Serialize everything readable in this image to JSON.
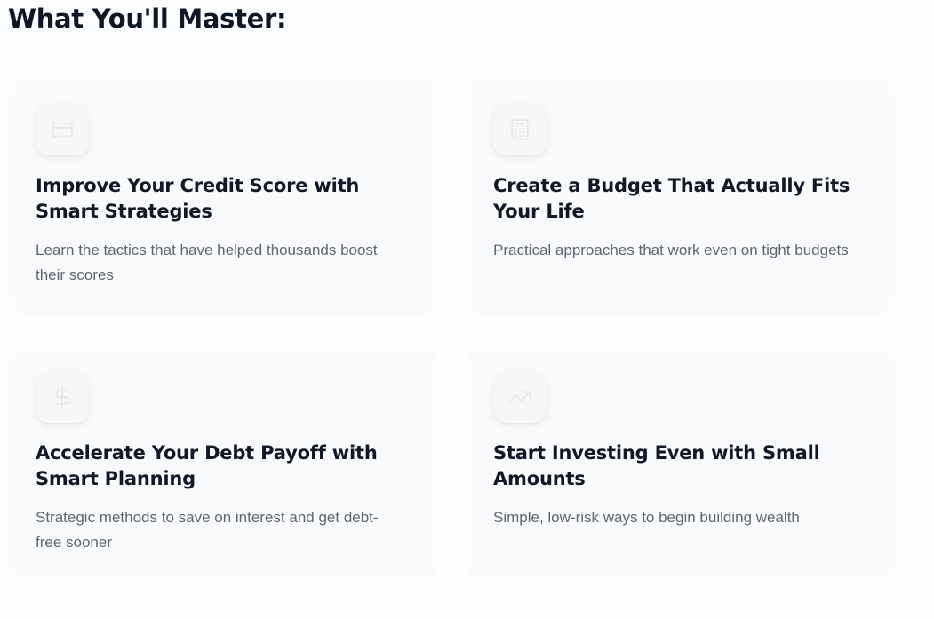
{
  "section": {
    "title": "What You'll Master:"
  },
  "cards": [
    {
      "icon": "credit-card-icon",
      "title": "Improve Your Credit Score with Smart Strategies",
      "description": "Learn the tactics that have helped thousands boost their scores"
    },
    {
      "icon": "calculator-icon",
      "title": "Create a Budget That Actually Fits Your Life",
      "description": "Practical approaches that work even on tight budgets"
    },
    {
      "icon": "dollar-icon",
      "title": "Accelerate Your Debt Payoff with Smart Planning",
      "description": "Strategic methods to save on interest and get debt-free sooner"
    },
    {
      "icon": "trending-up-icon",
      "title": "Start Investing Even with Small Amounts",
      "description": "Simple, low-risk ways to begin building wealth"
    }
  ],
  "colors": {
    "background": "#fbfcfd",
    "card": "#f9fafb",
    "title": "#121826",
    "description": "#5f6673",
    "icon_stroke": "#e6e8eb"
  }
}
